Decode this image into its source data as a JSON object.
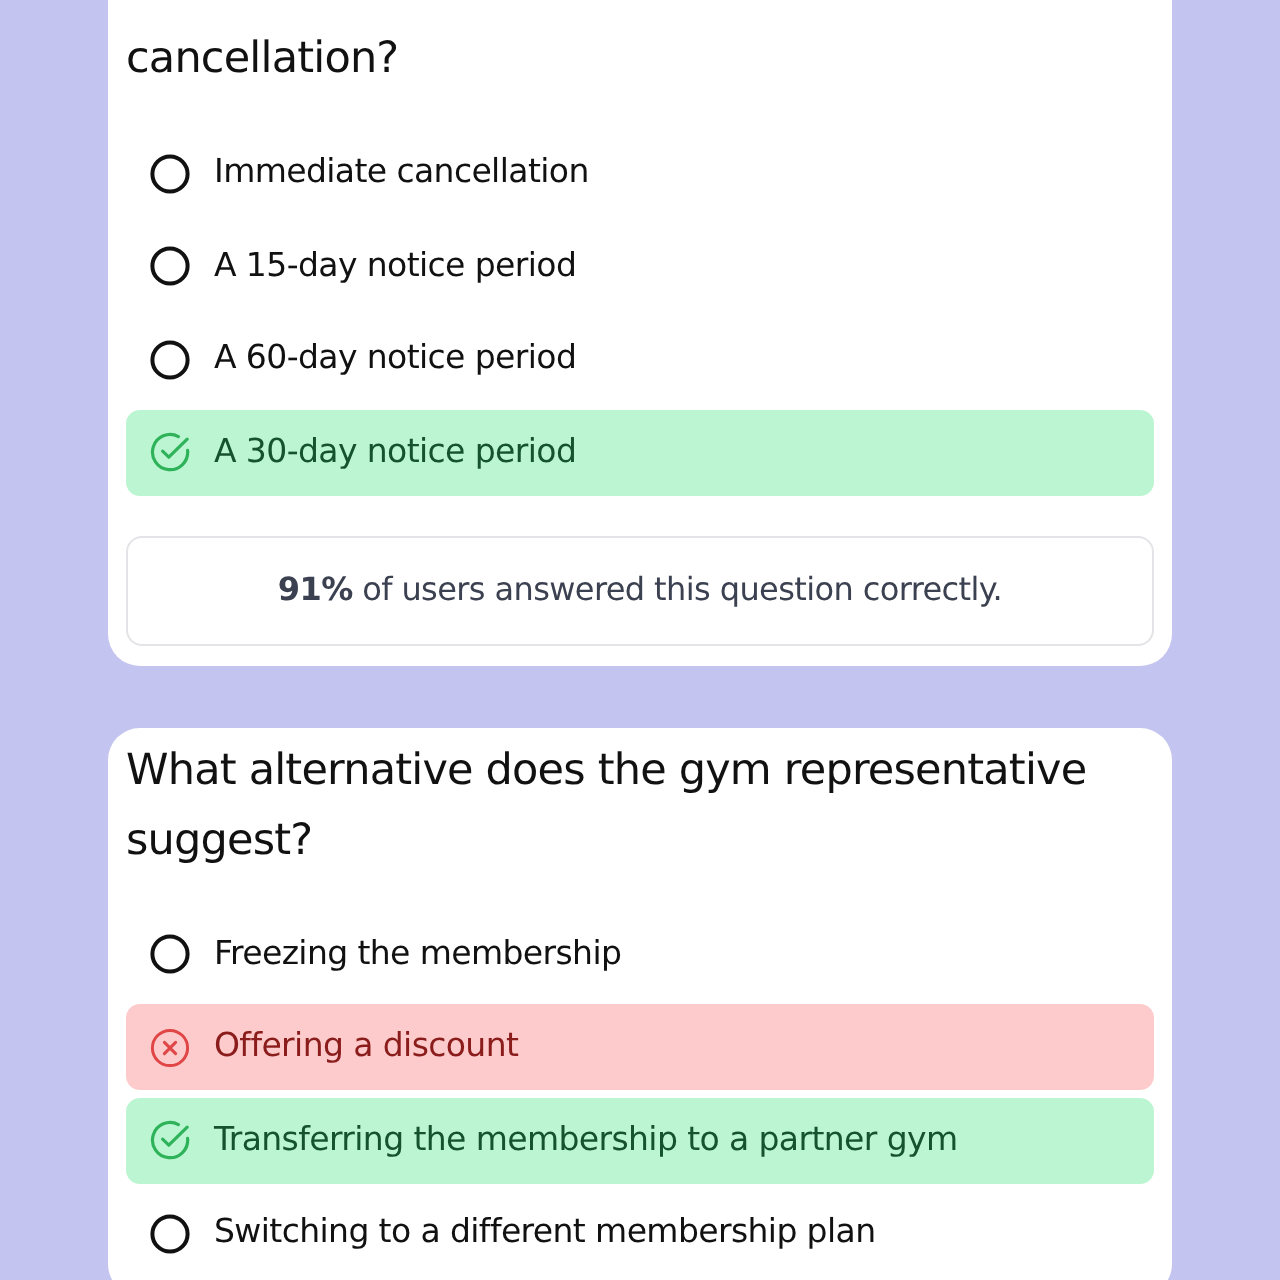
{
  "questions": [
    {
      "question": "cancellation?",
      "options": [
        {
          "label": "Immediate cancellation",
          "kind": "plain"
        },
        {
          "label": "A 15-day notice period",
          "kind": "plain"
        },
        {
          "label": "A 60-day notice period",
          "kind": "plain"
        },
        {
          "label": "A 30-day notice period",
          "kind": "correct"
        }
      ],
      "stats": "**91%** of users answered this question correctly."
    },
    {
      "question": "What alternative does the gym representative suggest?",
      "options": [
        {
          "label": "Freezing the membership",
          "kind": "plain"
        },
        {
          "label": "Offering a discount",
          "kind": "incorrect"
        },
        {
          "label": "Transferring the membership to a partner gym",
          "kind": "correct"
        },
        {
          "label": "Switching to a different membership plan",
          "kind": "plain"
        }
      ]
    }
  ]
}
